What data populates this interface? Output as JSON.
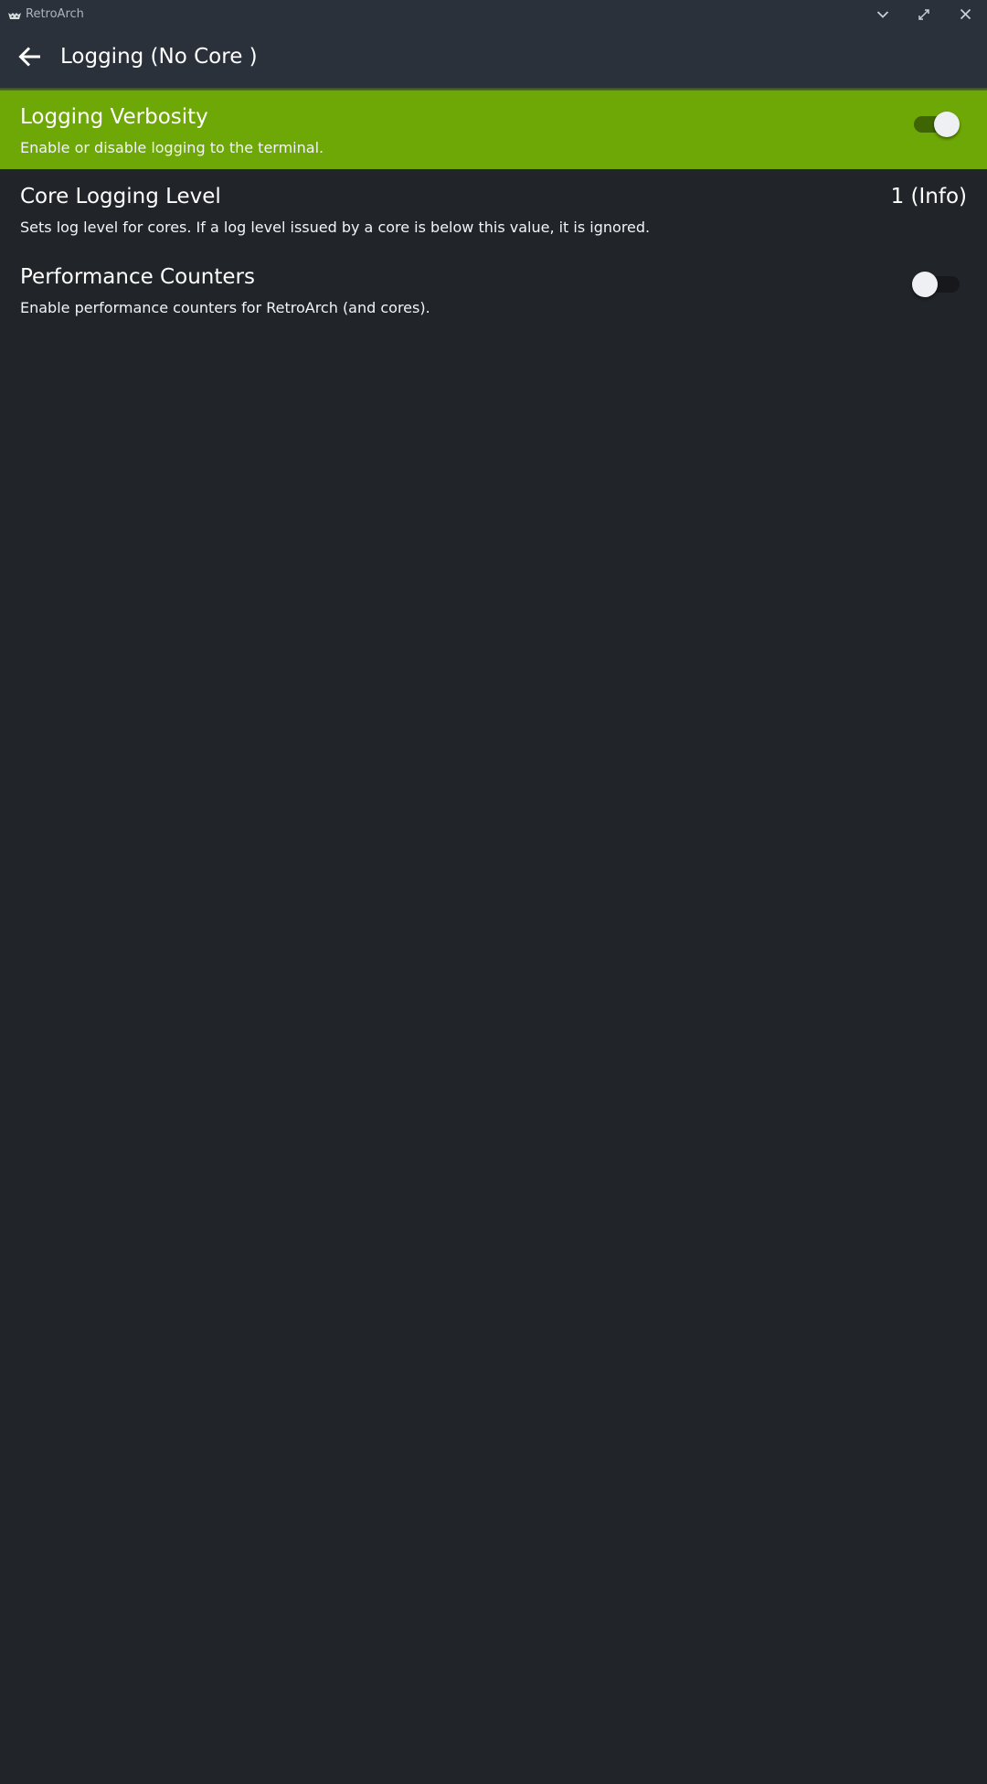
{
  "window": {
    "app_name": "RetroArch",
    "icon": "retroarch-logo-icon",
    "controls": [
      "chevron-down-icon",
      "maximize-icon",
      "close-icon"
    ]
  },
  "header": {
    "back_icon": "arrow-left-icon",
    "title": "Logging (No Core )"
  },
  "settings": [
    {
      "title": "Logging Verbosity",
      "description": "Enable or disable logging to the terminal.",
      "type": "toggle",
      "enabled": true,
      "selected": true
    },
    {
      "title": "Core Logging Level",
      "description": "Sets log level for cores. If a log level issued by a core is below this value, it is ignored.",
      "type": "value",
      "value": "1 (Info)",
      "selected": false
    },
    {
      "title": "Performance Counters",
      "description": "Enable performance counters for RetroArch (and cores).",
      "type": "toggle",
      "enabled": false,
      "selected": false
    }
  ],
  "colors": {
    "background": "#212428",
    "header": "#2b313a",
    "selected_accent": "#6ea806"
  }
}
